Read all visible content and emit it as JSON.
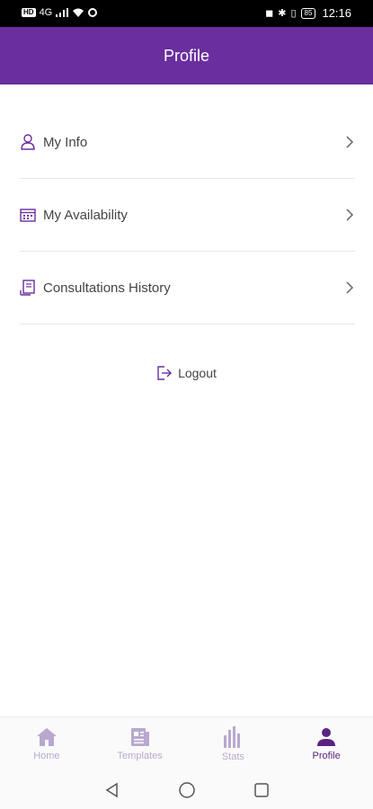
{
  "status_bar": {
    "carrier_chip": "HD",
    "network": "4G",
    "battery": "85",
    "time": "12:16"
  },
  "header": {
    "title": "Profile"
  },
  "menu": {
    "items": [
      {
        "label": "My Info",
        "icon": "person-icon"
      },
      {
        "label": "My Availability",
        "icon": "calendar-icon"
      },
      {
        "label": "Consultations History",
        "icon": "document-icon"
      }
    ]
  },
  "logout": {
    "label": "Logout"
  },
  "bottom_nav": {
    "tabs": [
      {
        "label": "Home",
        "icon": "home-icon",
        "active": false
      },
      {
        "label": "Templates",
        "icon": "templates-icon",
        "active": false
      },
      {
        "label": "Stats",
        "icon": "stats-icon",
        "active": false
      },
      {
        "label": "Profile",
        "icon": "profile-icon",
        "active": true
      }
    ]
  },
  "colors": {
    "primary": "#6a2e9e",
    "active_tab": "#5a237f",
    "inactive_tab": "#b9a8cf",
    "divider": "#e8e8e8"
  }
}
